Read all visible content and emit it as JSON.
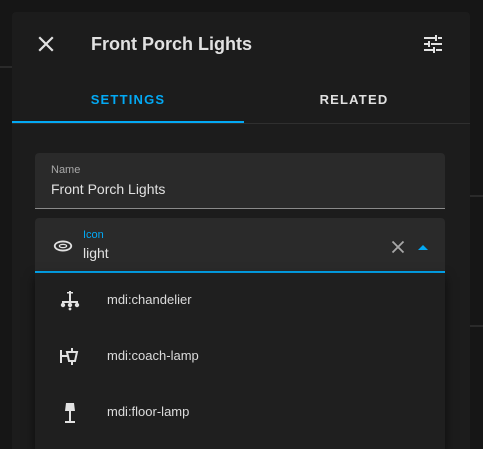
{
  "dialog": {
    "title": "Front Porch Lights",
    "close_icon": "close-icon",
    "settings_icon": "tune-icon"
  },
  "tabs": [
    {
      "label": "SETTINGS",
      "active": true
    },
    {
      "label": "RELATED",
      "active": false
    }
  ],
  "name_field": {
    "label": "Name",
    "value": "Front Porch Lights"
  },
  "icon_field": {
    "label": "Icon",
    "value": "light",
    "leading_icon": "ring-icon",
    "clear_icon": "close-icon",
    "dropdown_icon": "menu-up-icon"
  },
  "options": [
    {
      "label": "mdi:chandelier",
      "icon": "chandelier-icon"
    },
    {
      "label": "mdi:coach-lamp",
      "icon": "coach-lamp-icon"
    },
    {
      "label": "mdi:floor-lamp",
      "icon": "floor-lamp-icon"
    }
  ],
  "colors": {
    "accent": "#03a9f4",
    "surface": "#1c1c1c",
    "field": "#2a2a2a",
    "text": "#e1e1e1"
  }
}
